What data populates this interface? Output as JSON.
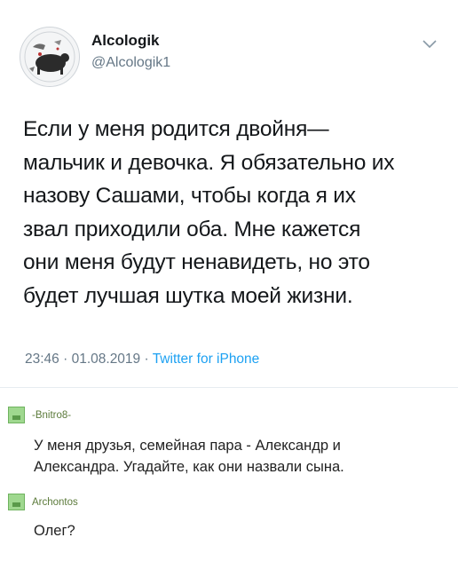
{
  "tweet": {
    "author_name": "Alcologik",
    "author_handle": "@Alcologik1",
    "avatar_icon": "avatar-illustration-icon",
    "menu_icon": "chevron-down-icon",
    "lines": [
      "Если у меня родится двойня—",
      "мальчик и девочка. Я обязательно их",
      "назову Сашами, чтобы когда я их",
      "звал приходили оба. Мне кажется",
      "они меня будут ненавидеть, но это",
      "будет лучшая шутка моей жизни."
    ],
    "time": "23:46",
    "date": "01.08.2019",
    "source": "Twitter for iPhone",
    "separator": "·"
  },
  "comments": [
    {
      "author": "-Bnitro8-",
      "lines": [
        "У меня друзья, семейная пара - Александр и",
        "Александра. Угадайте, как они назвали сына."
      ]
    },
    {
      "author": "Archontos",
      "lines": [
        "Олег?"
      ]
    }
  ],
  "colors": {
    "text": "#14171a",
    "secondary": "#657786",
    "link": "#1da1f2",
    "comment_author": "#5b7a3a",
    "comment_avatar": "#9fd88f"
  }
}
